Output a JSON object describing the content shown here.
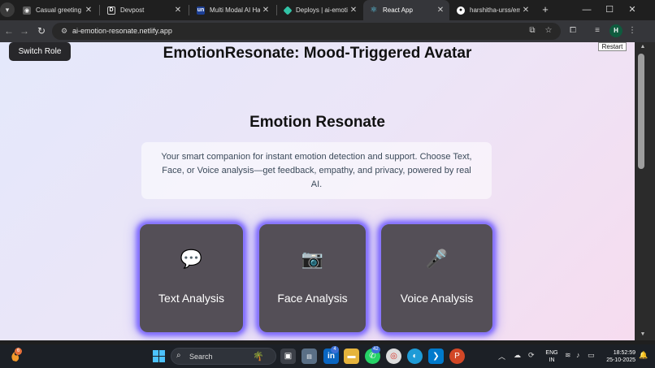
{
  "browser": {
    "tabs": [
      {
        "label": "Casual greeting exch",
        "favicon": "chat-icon",
        "color": "#6b6b6b",
        "active": false
      },
      {
        "label": "Devpost",
        "favicon": "devpost-logo",
        "color": "#1f1f1f",
        "active": false
      },
      {
        "label": "Multi Modal AI Hack",
        "favicon": "unstop-logo",
        "color": "#1c3f95",
        "active": false
      },
      {
        "label": "Deploys | ai-emotio",
        "favicon": "netlify-logo",
        "color": "#32c3a6",
        "active": false
      },
      {
        "label": "React App",
        "favicon": "react-logo",
        "color": "#61dafb",
        "active": true
      },
      {
        "label": "harshitha-urss/emot",
        "favicon": "github-logo",
        "color": "#ffffff",
        "active": false
      }
    ],
    "new_tab": "+",
    "url": "ai-emotion-resonate.netlify.app",
    "profile_initial": "H"
  },
  "page": {
    "switch_role": "Switch Role",
    "restart": "Restart",
    "title": "EmotionResonate: Mood-Triggered Avatar",
    "subtitle": "Emotion Resonate",
    "description": "Your smart companion for instant emotion detection and support. Choose Text, Face, or Voice analysis—get feedback, empathy, and privacy, powered by real AI.",
    "cards": [
      {
        "label": "Text Analysis",
        "icon": "speech-bubble-icon",
        "glyph": "💬"
      },
      {
        "label": "Face Analysis",
        "icon": "camera-icon",
        "glyph": "📷"
      },
      {
        "label": "Voice Analysis",
        "icon": "microphone-icon",
        "glyph": "🎤"
      }
    ]
  },
  "taskbar": {
    "weather_badge": "6",
    "search_placeholder": "Search",
    "linkedin_badge": "4",
    "whatsapp_badge": "42",
    "language": "ENG",
    "region": "IN",
    "time": "18:52:59",
    "date": "25-10-2025"
  },
  "colors": {
    "card_bg": "#544f57",
    "card_glow": "#7b66ff",
    "page_gradient_start": "#e4e8fb",
    "page_gradient_end": "#f6dcef"
  }
}
